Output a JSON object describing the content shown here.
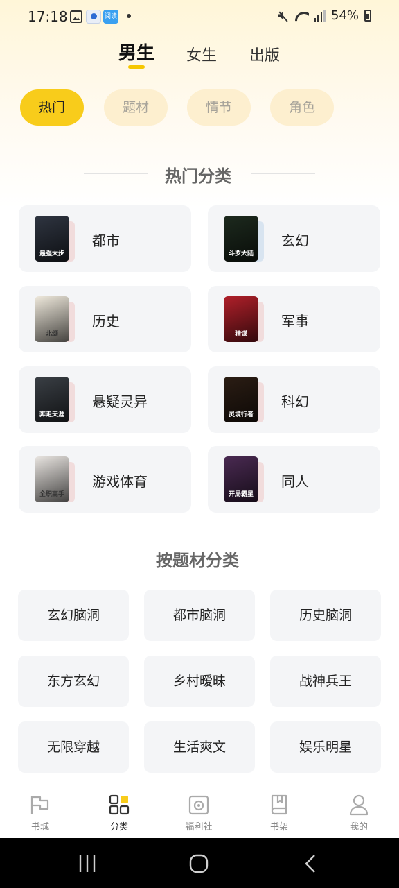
{
  "status_bar": {
    "time": "17:18",
    "battery": "54%",
    "app_badge_text": "阅读"
  },
  "gender_tabs": [
    {
      "label": "男生",
      "active": true
    },
    {
      "label": "女生",
      "active": false
    },
    {
      "label": "出版",
      "active": false
    }
  ],
  "filter_chips": [
    {
      "label": "热门",
      "active": true
    },
    {
      "label": "题材",
      "active": false
    },
    {
      "label": "情节",
      "active": false
    },
    {
      "label": "角色",
      "active": false
    }
  ],
  "hot_section": {
    "title": "热门分类",
    "items": [
      {
        "label": "都市",
        "cover_text": "最强大步",
        "cover_color": "#2f3541",
        "shadow_color": "#f1dcdc"
      },
      {
        "label": "玄幻",
        "cover_text": "斗罗大陆",
        "cover_color": "#1d2a1e",
        "shadow_color": "#d8e4f0"
      },
      {
        "label": "历史",
        "cover_text": "北颂",
        "cover_color": "#efe9dc",
        "shadow_color": "#f1dcdc"
      },
      {
        "label": "军事",
        "cover_text": "猎谍",
        "cover_color": "#b0202a",
        "shadow_color": "#f1dcdc"
      },
      {
        "label": "悬疑灵异",
        "cover_text": "奔走天涯",
        "cover_color": "#3a3f45",
        "shadow_color": "#f1dcdc"
      },
      {
        "label": "科幻",
        "cover_text": "灵境行者",
        "cover_color": "#2b1d14",
        "shadow_color": "#f1dcdc"
      },
      {
        "label": "游戏体育",
        "cover_text": "全职高手",
        "cover_color": "#e8e4e0",
        "shadow_color": "#f1dcdc"
      },
      {
        "label": "同人",
        "cover_text": "开局霸星",
        "cover_color": "#4a2a52",
        "shadow_color": "#f1dcdc"
      }
    ]
  },
  "topic_section": {
    "title": "按题材分类",
    "items": [
      "玄幻脑洞",
      "都市脑洞",
      "历史脑洞",
      "东方玄幻",
      "乡村暧昧",
      "战神兵王",
      "无限穿越",
      "生活爽文",
      "娱乐明星"
    ]
  },
  "bottom_nav": [
    {
      "label": "书城",
      "icon": "flag-icon",
      "active": false
    },
    {
      "label": "分类",
      "icon": "grid-icon",
      "active": true
    },
    {
      "label": "福利社",
      "icon": "gift-icon",
      "active": false
    },
    {
      "label": "书架",
      "icon": "bookshelf-icon",
      "active": false
    },
    {
      "label": "我的",
      "icon": "profile-icon",
      "active": false
    }
  ],
  "colors": {
    "accent": "#f8cc1b",
    "chip_inactive": "#fdefcf",
    "card_bg": "#f4f5f7"
  }
}
